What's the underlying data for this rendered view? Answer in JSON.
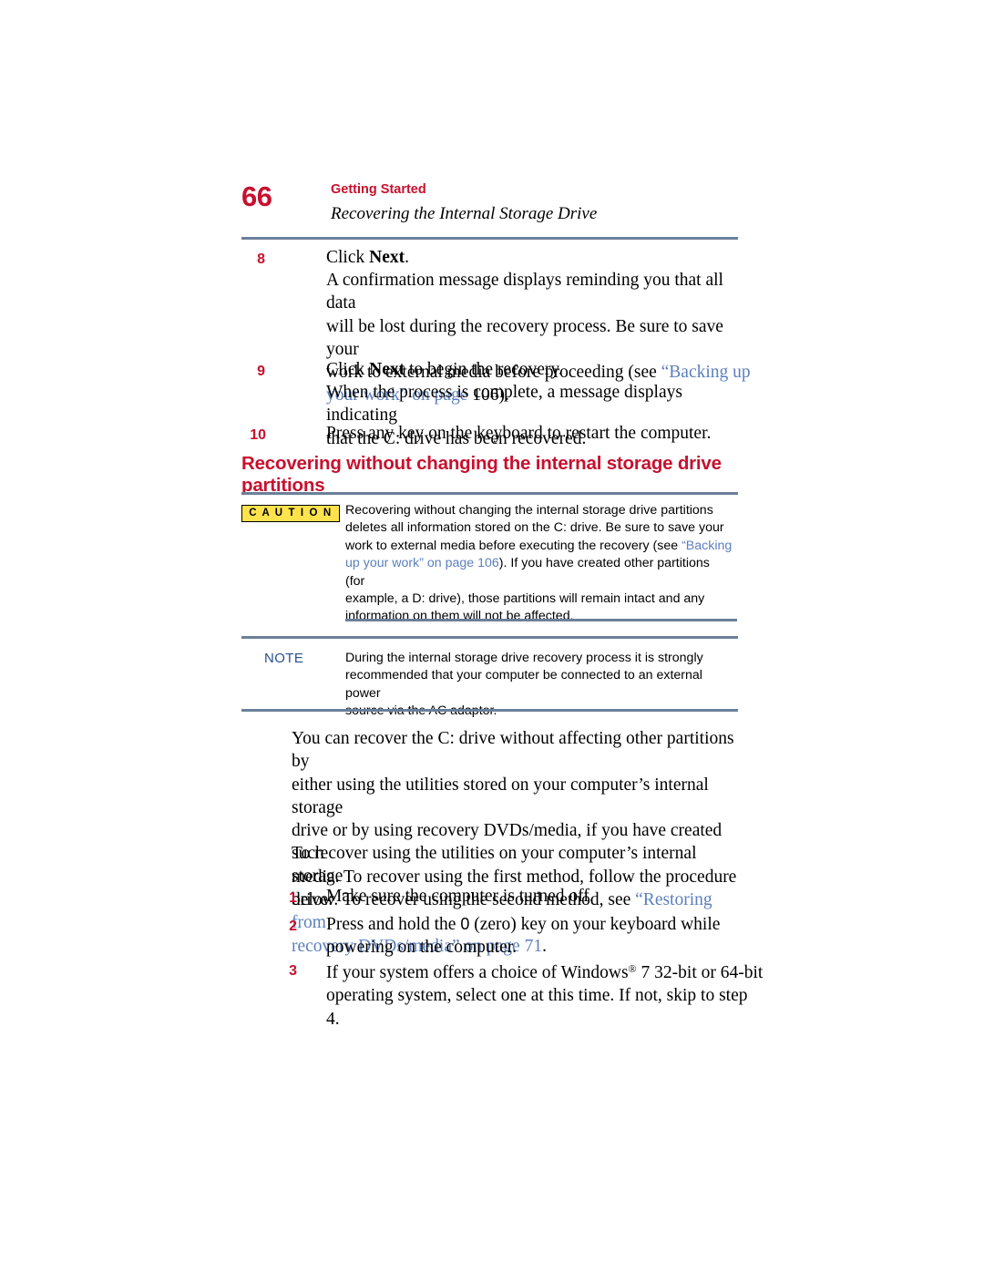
{
  "header": {
    "page_number": "66",
    "chapter": "Getting Started",
    "section": "Recovering the Internal Storage Drive"
  },
  "steps_top": [
    {
      "num": "8",
      "lines": [
        {
          "segments": [
            {
              "t": "Click ",
              "style": "normal"
            },
            {
              "t": "Next",
              "style": "bold"
            },
            {
              "t": ".",
              "style": "normal"
            }
          ]
        }
      ]
    }
  ],
  "step8": {
    "num": "8",
    "line1_pre": "Click ",
    "line1_bold": "Next",
    "line1_post": ".",
    "body_line1": "A confirmation message displays reminding you that all data",
    "body_line2": "will be lost during the recovery process. Be sure to save your",
    "body_line3_pre": "work to external media before proceeding (see ",
    "body_line3_link": "“Backing up",
    "body_line4_link": "your work” on page",
    "body_line4_post": " 106).",
    "body_line4_page": "106"
  },
  "step9": {
    "num": "9",
    "line1_pre": "Click ",
    "line1_bold": "Next",
    "line1_post": " to begin the recovery.",
    "body_line1": "When the process is complete, a message displays indicating",
    "body_line2": "that the C: drive has been recovered."
  },
  "step10": {
    "num": "10",
    "line1": "Press any key on the keyboard to restart the computer."
  },
  "red_heading": "Recovering without changing the internal storage drive partitions",
  "caution": {
    "badge": "C A U T I O N",
    "line1": "Recovering without changing the internal storage drive partitions",
    "line2": "deletes all information stored on the C: drive. Be sure to save your",
    "line3_pre": "work to external media before executing the recovery (see ",
    "line3_link": "“Backing",
    "line4_link": "up your work” on page 106",
    "line4_post": "). If you have created other partitions (for",
    "line5": "example, a D: drive), those partitions will remain intact and any",
    "line6": "information on them will not be affected."
  },
  "note": {
    "label": "NOTE",
    "line1": "During the internal storage drive recovery process it is strongly",
    "line2": "recommended that your computer be connected to an external power",
    "line3": "source via the AC adaptor."
  },
  "body1": {
    "line1": "You can recover the C: drive without affecting other partitions by",
    "line2": "either using the utilities stored on your computer’s internal storage",
    "line3": "drive or by using recovery DVDs/media, if you have created such",
    "line4": "media. To recover using the first method, follow the procedure",
    "line5_pre": "below. To recover using the second method, see ",
    "line5_link": "“Restoring from",
    "line6_link": "recovery DVDs/media” on page 71",
    "line6_post": "."
  },
  "body2": {
    "line1": "To recover using the utilities on your computer’s internal storage",
    "line2": "drive:"
  },
  "steps_bottom": [
    {
      "num": "1",
      "line1": "Make sure the computer is turned off."
    },
    {
      "num": "2",
      "line1_pre": "Press and hold the ",
      "line1_zero": "0",
      "line1_post": " (zero) key on your keyboard while",
      "line2": "powering on the computer."
    },
    {
      "num": "3",
      "line1_pre": "If your system offers a choice of Windows",
      "line1_sup": "®",
      "line1_post": " 7 32-bit or 64-bit",
      "line2": "operating system, select one at this time. If not, skip to step 4."
    }
  ]
}
